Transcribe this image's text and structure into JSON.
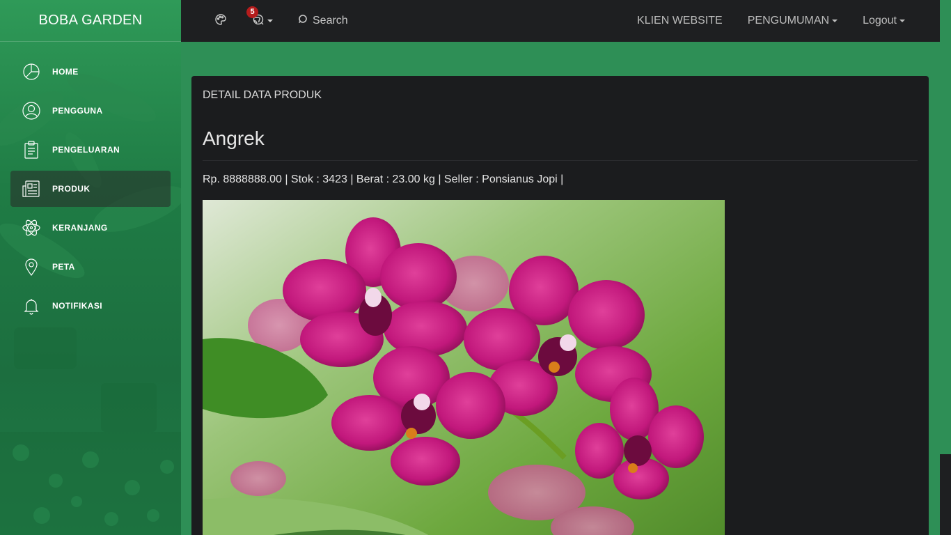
{
  "app": {
    "brand": "BOBA GARDEN"
  },
  "sidebar": {
    "items": [
      {
        "label": "HOME",
        "icon": "pie-chart-icon"
      },
      {
        "label": "PENGGUNA",
        "icon": "user-circle-icon"
      },
      {
        "label": "PENGELUARAN",
        "icon": "clipboard-icon"
      },
      {
        "label": "PRODUK",
        "icon": "newspaper-icon",
        "active": true
      },
      {
        "label": "KERANJANG",
        "icon": "atom-icon"
      },
      {
        "label": "PETA",
        "icon": "map-pin-icon"
      },
      {
        "label": "NOTIFIKASI",
        "icon": "bell-icon"
      }
    ]
  },
  "topbar": {
    "palette_icon": "palette-icon",
    "notif_icon": "world-icon",
    "notif_count": "5",
    "search_label": "Search",
    "links": {
      "klien": "KLIEN WEBSITE",
      "pengumuman": "PENGUMUMAN",
      "logout": "Logout"
    }
  },
  "card": {
    "header": "DETAIL DATA PRODUK",
    "product_name": "Angrek",
    "meta": "Rp. 8888888.00 | Stok : 3423 | Berat : 23.00 kg | Seller : Ponsianus Jopi |"
  },
  "colors": {
    "accent_green": "#2e8f56",
    "topbar_dark": "#1e1f21",
    "card_dark": "#1b1c1e",
    "badge_red": "#b51c1c",
    "orchid_magenta": "#c2187c"
  }
}
